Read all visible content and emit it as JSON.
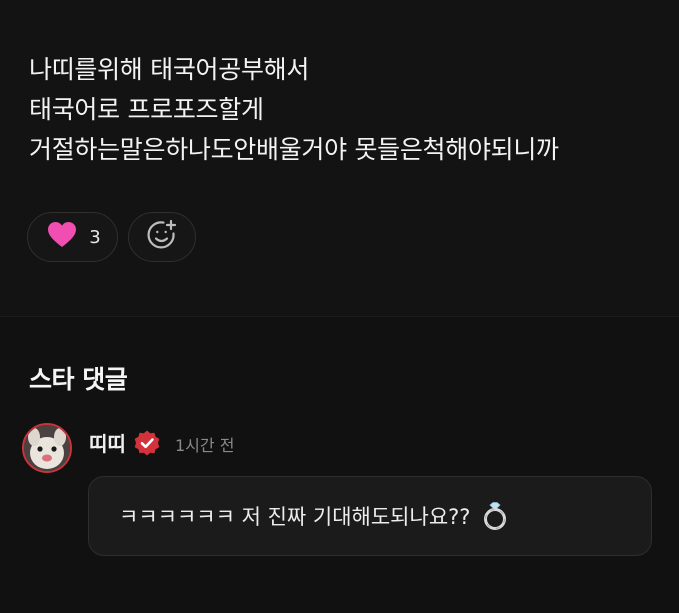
{
  "post": {
    "lines": [
      "나띠를위해 태국어공부해서",
      "태국어로 프로포즈할게",
      "거절하는말은하나도안배울거야 못들은척해야되니까"
    ],
    "reactions": {
      "like_icon": "heart-icon",
      "like_count": "3",
      "add_icon": "add-emoji-icon"
    }
  },
  "comments_section": {
    "title": "스타 댓글",
    "comment": {
      "author": "띠띠",
      "verified_icon": "verified-badge-icon",
      "time": "1시간 전",
      "text": "ㅋㅋㅋㅋㅋㅋ 저 진짜 기대해도되나요??",
      "emoji": "ring-icon"
    }
  },
  "colors": {
    "heart": "#f04eb0",
    "verified": "#d3323c",
    "avatar_ring": "#c8343a",
    "background": "#121212"
  }
}
